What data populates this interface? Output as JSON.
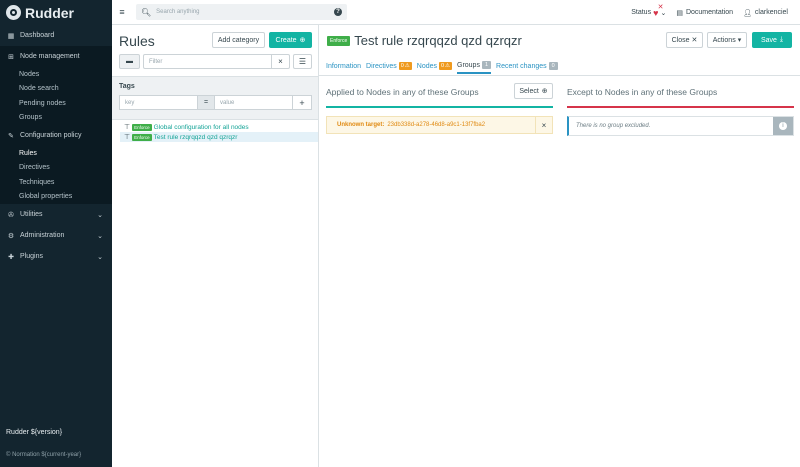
{
  "app": {
    "name": "Rudder"
  },
  "sidebar": {
    "dashboard": "Dashboard",
    "node_management": "Node management",
    "node_items": [
      "Nodes",
      "Node search",
      "Pending nodes",
      "Groups"
    ],
    "configuration_policy": "Configuration policy",
    "config_items": [
      "Rules",
      "Directives",
      "Techniques",
      "Global properties"
    ],
    "utilities": "Utilities",
    "administration": "Administration",
    "plugins": "Plugins",
    "version": "Rudder ${version}",
    "copyright": "© Normation ${current-year}"
  },
  "topbar": {
    "search_placeholder": "Search anything",
    "status": "Status",
    "documentation": "Documentation",
    "user": "clarkenciel"
  },
  "rules_panel": {
    "title": "Rules",
    "add_category": "Add category",
    "create": "Create",
    "filter_placeholder": "Filter",
    "tags_label": "Tags",
    "tag_key_placeholder": "key",
    "tag_eq": "=",
    "tag_value_placeholder": "value",
    "tree": [
      {
        "badge": "Enforce",
        "label": "Global configuration for all nodes",
        "selected": false
      },
      {
        "badge": "Enforce",
        "label": "Test rule rzqrqqzd qzd qzrqzr",
        "selected": true
      }
    ]
  },
  "rule": {
    "badge": "Enforce",
    "title": "Test rule rzqrqqzd qzd qzrqzr",
    "close": "Close",
    "actions": "Actions",
    "save": "Save",
    "tabs": [
      {
        "label": "Information",
        "count": null
      },
      {
        "label": "Directives",
        "count": "0"
      },
      {
        "label": "Nodes",
        "count": "0"
      },
      {
        "label": "Groups",
        "count": "1"
      },
      {
        "label": "Recent changes",
        "count": "0"
      }
    ],
    "applied_title": "Applied to Nodes in any of these Groups",
    "select": "Select",
    "unknown_label": "Unknown target:",
    "unknown_value": "23db338d-a278-46d8-a9c1-13f7fba2",
    "except_title": "Except to Nodes in any of these Groups",
    "no_group": "There is no group excluded."
  },
  "colors": {
    "accent": "#13b4a3",
    "link": "#2a93c3",
    "danger": "#d6344a",
    "warning": "#ef9a1f",
    "sidebar": "#13252f"
  }
}
